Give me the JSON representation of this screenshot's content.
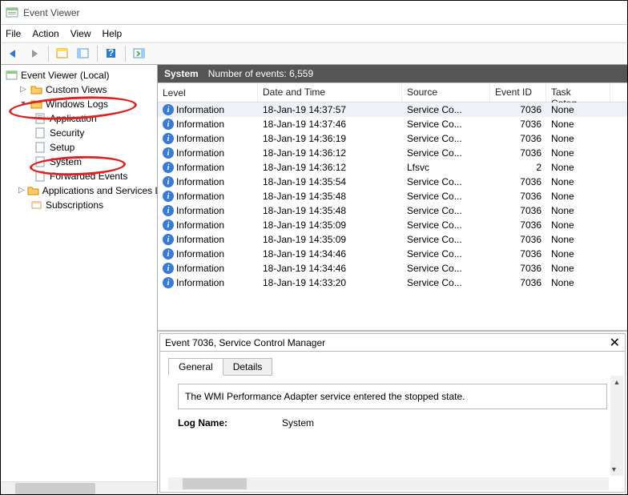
{
  "window": {
    "title": "Event Viewer"
  },
  "menu": {
    "file": "File",
    "action": "Action",
    "view": "View",
    "help": "Help"
  },
  "nav": {
    "root": "Event Viewer (Local)",
    "custom": "Custom Views",
    "winlogs": "Windows Logs",
    "app": "Application",
    "sec": "Security",
    "setup": "Setup",
    "system": "System",
    "fwd": "Forwarded Events",
    "appsvc": "Applications and Services Lo",
    "subs": "Subscriptions"
  },
  "context": {
    "name": "System",
    "countlabel": "Number of events: 6,559"
  },
  "columns": {
    "level": "Level",
    "date": "Date and Time",
    "src": "Source",
    "eid": "Event ID",
    "task": "Task Categ..."
  },
  "rows": [
    {
      "level": "Information",
      "date": "18-Jan-19 14:37:57",
      "src": "Service Co...",
      "eid": "7036",
      "task": "None",
      "sel": true
    },
    {
      "level": "Information",
      "date": "18-Jan-19 14:37:46",
      "src": "Service Co...",
      "eid": "7036",
      "task": "None"
    },
    {
      "level": "Information",
      "date": "18-Jan-19 14:36:19",
      "src": "Service Co...",
      "eid": "7036",
      "task": "None"
    },
    {
      "level": "Information",
      "date": "18-Jan-19 14:36:12",
      "src": "Service Co...",
      "eid": "7036",
      "task": "None"
    },
    {
      "level": "Information",
      "date": "18-Jan-19 14:36:12",
      "src": "Lfsvc",
      "eid": "2",
      "task": "None"
    },
    {
      "level": "Information",
      "date": "18-Jan-19 14:35:54",
      "src": "Service Co...",
      "eid": "7036",
      "task": "None"
    },
    {
      "level": "Information",
      "date": "18-Jan-19 14:35:48",
      "src": "Service Co...",
      "eid": "7036",
      "task": "None"
    },
    {
      "level": "Information",
      "date": "18-Jan-19 14:35:48",
      "src": "Service Co...",
      "eid": "7036",
      "task": "None"
    },
    {
      "level": "Information",
      "date": "18-Jan-19 14:35:09",
      "src": "Service Co...",
      "eid": "7036",
      "task": "None"
    },
    {
      "level": "Information",
      "date": "18-Jan-19 14:35:09",
      "src": "Service Co...",
      "eid": "7036",
      "task": "None"
    },
    {
      "level": "Information",
      "date": "18-Jan-19 14:34:46",
      "src": "Service Co...",
      "eid": "7036",
      "task": "None"
    },
    {
      "level": "Information",
      "date": "18-Jan-19 14:34:46",
      "src": "Service Co...",
      "eid": "7036",
      "task": "None"
    },
    {
      "level": "Information",
      "date": "18-Jan-19 14:33:20",
      "src": "Service Co...",
      "eid": "7036",
      "task": "None"
    }
  ],
  "detail": {
    "title": "Event 7036, Service Control Manager",
    "tabs": {
      "general": "General",
      "details": "Details"
    },
    "message": "The WMI Performance Adapter service entered the stopped state.",
    "lognamek": "Log Name:",
    "lognamev": "System"
  }
}
